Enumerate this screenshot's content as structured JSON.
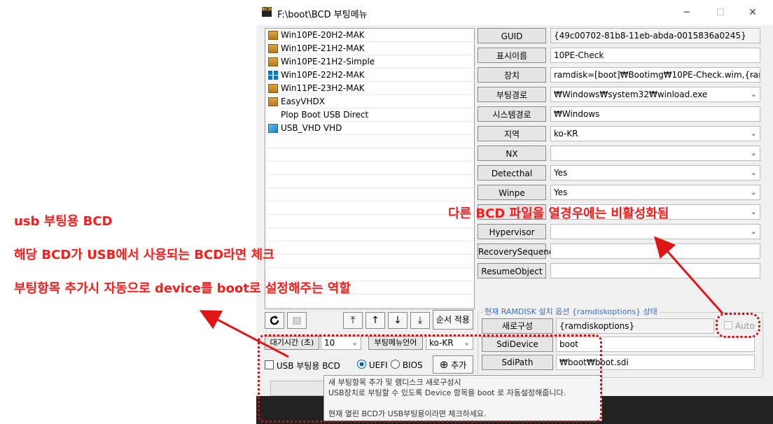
{
  "window": {
    "title": "F:\\boot\\BCD 부팅메뉴",
    "icon_text": "BCD"
  },
  "boot_entries": [
    {
      "label": "Win10PE-20H2-MAK",
      "icon": "pe"
    },
    {
      "label": "Win10PE-21H2-MAK",
      "icon": "pe"
    },
    {
      "label": "Win10PE-21H2-Simple",
      "icon": "pe"
    },
    {
      "label": "Win10PE-22H2-MAK",
      "icon": "win"
    },
    {
      "label": "Win11PE-23H2-MAK",
      "icon": "pe"
    },
    {
      "label": "EasyVHDX",
      "icon": "pe"
    },
    {
      "label": "Plop Boot USB Direct",
      "icon": "none"
    },
    {
      "label": "USB_VHD VHD",
      "icon": "vhd"
    }
  ],
  "properties": [
    {
      "name": "GUID",
      "value": "{49c00702-81b8-11eb-abda-0015836a0245}",
      "dropdown": false
    },
    {
      "name": "표시이름",
      "value": "10PE-Check",
      "dropdown": false
    },
    {
      "name": "장치",
      "value": "ramdisk=[boot]₩Bootimg₩10PE-Check.wim,{ramdi",
      "dropdown": true
    },
    {
      "name": "부팅경로",
      "value": "₩Windows₩system32₩winload.exe",
      "dropdown": true
    },
    {
      "name": "시스템경로",
      "value": "₩Windows",
      "dropdown": false
    },
    {
      "name": "지역",
      "value": "ko-KR",
      "dropdown": true
    },
    {
      "name": "NX",
      "value": "",
      "dropdown": true
    },
    {
      "name": "Detecthal",
      "value": "Yes",
      "dropdown": true
    },
    {
      "name": "Winpe",
      "value": "Yes",
      "dropdown": true
    },
    {
      "name": "",
      "value": "",
      "dropdown": true
    },
    {
      "name": "Hypervisor",
      "value": "",
      "dropdown": true
    },
    {
      "name": "RecoverySequenc",
      "value": "",
      "dropdown": false
    },
    {
      "name": "ResumeObject",
      "value": "",
      "dropdown": false
    }
  ],
  "toolbar": {
    "refresh_icon": "refresh-icon",
    "list_icon": "list-icon",
    "apply_order": "순서 적용"
  },
  "timeout": {
    "label": "대기시간 (초)",
    "value": "10"
  },
  "menu_lang": {
    "label": "부팅메뉴언어",
    "value": "ko-KR"
  },
  "usb_boot": {
    "label": "USB 부팅용 BCD",
    "checked": false
  },
  "firmware": {
    "uefi": "UEFI",
    "bios": "BIOS",
    "selected": "UEFI"
  },
  "add_button": "추가",
  "ramdisk": {
    "group_title": "현재 RAMDISK 설치 옵션 {ramdiskoptions} 상태",
    "rebuild_label": "새로구성",
    "rebuild_value": "{ramdiskoptions}",
    "auto_label": "Auto",
    "sdidevice_label": "SdiDevice",
    "sdidevice_value": "boot",
    "sdipath_label": "SdiPath",
    "sdipath_value": "₩boot₩boot.sdi"
  },
  "tooltip": {
    "line1": "새 부팅항목 추가 및 램디스크 새로구성시",
    "line2": "USB장치로 부팅할 수 있도록  Device 항목을 boot 로 자동설정해줍니다.",
    "line3": "현재 열린 BCD가 USB부팅용이라면 체크하세요."
  },
  "annotations": {
    "left1": "usb 부팅용 BCD",
    "left2": "해당 BCD가 USB에서 사용되는 BCD라면 체크",
    "left3": "부팅항목 추가시 자동으로 device를 boot로 설정해주는 역할",
    "right": "다른 BCD 파일을 열경우에는 비활성화됨"
  }
}
